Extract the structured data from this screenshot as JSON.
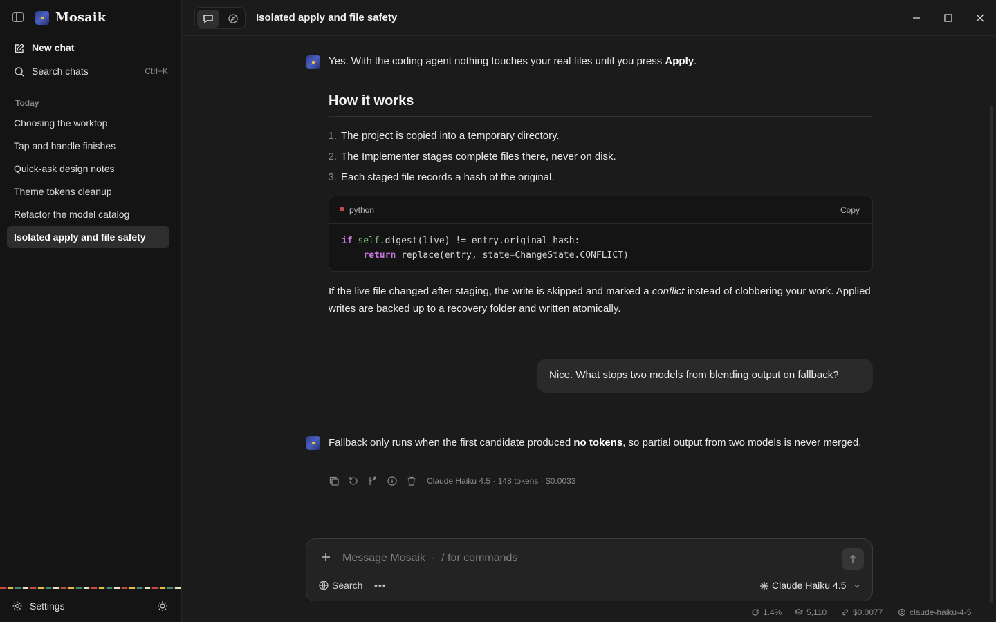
{
  "app": {
    "name": "Mosaik"
  },
  "sidebar": {
    "new_chat": "New chat",
    "search_chats": "Search chats",
    "search_shortcut": "Ctrl+K",
    "section_label": "Today",
    "chats": [
      "Choosing the worktop",
      "Tap and handle finishes",
      "Quick-ask design notes",
      "Theme tokens cleanup",
      "Refactor the model catalog",
      "Isolated apply and file safety"
    ],
    "active_chat_index": 5,
    "settings": "Settings"
  },
  "topbar": {
    "title": "Isolated apply and file safety"
  },
  "messages": {
    "a1": {
      "intro_pre": "Yes. With the coding agent nothing touches your real files until you press ",
      "intro_bold": "Apply",
      "intro_post": ".",
      "heading": "How it works",
      "steps": [
        "The project is copied into a temporary directory.",
        "The Implementer stages complete files there, never on disk.",
        "Each staged file records a hash of the original."
      ],
      "code": {
        "language": "python",
        "copy_label": "Copy",
        "line1_kw": "if",
        "line1_self": "self",
        "line1_rest": ".digest(live) != entry.original_hash:",
        "line2_kw": "return",
        "line2_rest": " replace(entry, state=ChangeState.CONFLICT)"
      },
      "outro_pre": "If the live file changed after staging, the write is skipped and marked a ",
      "outro_em": "conflict",
      "outro_post": " instead of clobbering your work. Applied writes are backed up to a recovery folder and written atomically."
    },
    "user": "Nice. What stops two models from blending output on fallback?",
    "a2": {
      "pre": "Fallback only runs when the first candidate produced ",
      "bold": "no tokens",
      "post": ", so partial output from two models is never merged.",
      "meta": "Claude Haiku 4.5 · 148 tokens · $0.0033"
    }
  },
  "composer": {
    "placeholder": "Message Mosaik  ·  / for commands",
    "search_label": "Search",
    "model_label": "Claude Haiku 4.5"
  },
  "status": {
    "context": "1.4%",
    "tokens": "5,110",
    "cost": "$0.0077",
    "model_id": "claude-haiku-4-5"
  },
  "colors": {
    "background": "#1b1b1b",
    "sidebar": "#141414",
    "active_item": "#2e2e2e",
    "code_keyword": "#c678dd",
    "code_self": "#7ec07e"
  },
  "icons": [
    "sidebar-toggle-icon",
    "edit-icon",
    "search-icon",
    "chat-icon",
    "compass-icon",
    "minimize-icon",
    "maximize-icon",
    "close-icon",
    "copy-icon",
    "retry-icon",
    "branch-icon",
    "info-icon",
    "trash-icon",
    "plus-icon",
    "send-arrow-icon",
    "globe-icon",
    "more-icon",
    "sparkle-icon",
    "chevron-down-icon",
    "gear-icon",
    "sun-icon",
    "refresh-icon",
    "layers-icon",
    "link-icon"
  ]
}
